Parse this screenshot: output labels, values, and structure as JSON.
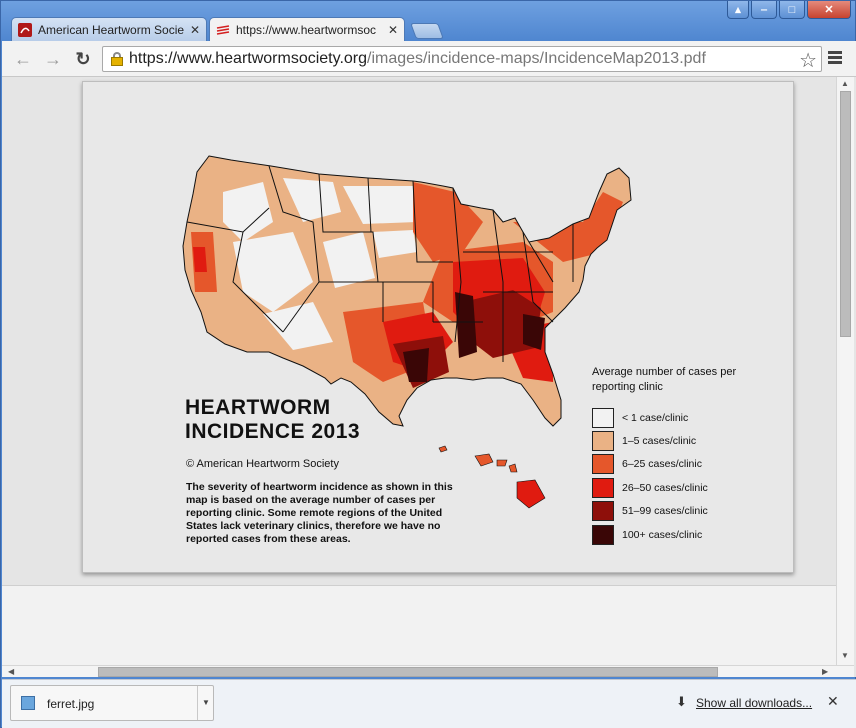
{
  "browser": {
    "tabs": [
      {
        "title": "American Heartworm Socie",
        "favicon": "heartworm-society-icon",
        "active": false
      },
      {
        "title": "https://www.heartwormsoc",
        "favicon": "pdf-stripes-icon",
        "active": true
      }
    ],
    "window_controls": {
      "user": "▴",
      "minimize": "‒",
      "maximize": "□",
      "close": "✕"
    }
  },
  "toolbar": {
    "back": "←",
    "forward": "→",
    "reload": "↻",
    "url_host": "https://www.heartwormsociety.org",
    "url_path": "/images/incidence-maps/IncidenceMap2013.pdf",
    "bookmark_star": "☆"
  },
  "pdf": {
    "title": "HEARTWORM\nINCIDENCE 2013",
    "copyright": "© American Heartworm Society",
    "description": "The severity of heartworm incidence as shown in this map is based on the average number of cases per reporting clinic. Some remote regions of the United States lack veterinary clinics, therefore we have no reported cases from these areas.",
    "legend": {
      "title": "Average number of cases per reporting clinic",
      "items": [
        {
          "label": "< 1 case/clinic",
          "color": "#f2f2f2"
        },
        {
          "label": "1–5 cases/clinic",
          "color": "#eab285"
        },
        {
          "label": "6–25 cases/clinic",
          "color": "#e5572b"
        },
        {
          "label": "26–50 cases/clinic",
          "color": "#e01b10"
        },
        {
          "label": "51–99 cases/clinic",
          "color": "#8e0f0a"
        },
        {
          "label": "100+ cases/clinic",
          "color": "#3a0606"
        }
      ]
    }
  },
  "scrollbars": {
    "up": "▲",
    "down": "▼",
    "left": "◀",
    "right": "▶"
  },
  "downloads": {
    "file": "ferret.jpg",
    "dropdown": "▼",
    "show_all": "Show all downloads...",
    "close": "✕",
    "arrow": "⬇"
  }
}
